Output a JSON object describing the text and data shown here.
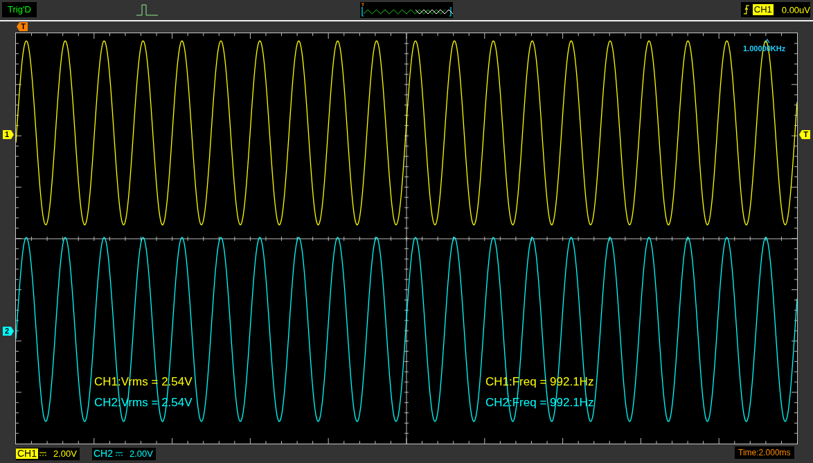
{
  "status": {
    "text": "Trig'D"
  },
  "trigger": {
    "source": "CH1",
    "value": "0.00uV",
    "color": "#ffff00"
  },
  "trigger_markers": {
    "top": "T",
    "right": "T"
  },
  "channel_markers": [
    {
      "label": "1",
      "color": "#ffff00"
    },
    {
      "label": "2",
      "color": "#00ffff"
    }
  ],
  "frequency_readout": "1.00000KHz",
  "measurements": [
    {
      "text": "CH1:Vrms = 2.54V",
      "color": "#ffff00"
    },
    {
      "text": "CH2:Vrms = 2.54V",
      "color": "#00ffff"
    },
    {
      "text": "CH1:Freq = 992.1Hz",
      "color": "#ffff00"
    },
    {
      "text": "CH2:Freq = 992.1Hz",
      "color": "#00ffff"
    }
  ],
  "channels": [
    {
      "name": "CH1",
      "scale": "2.00V",
      "color": "#ffff00",
      "selected": true
    },
    {
      "name": "CH2",
      "scale": "2.00V",
      "color": "#00ffff",
      "selected": false
    }
  ],
  "timebase": "Time:2.000ms"
}
